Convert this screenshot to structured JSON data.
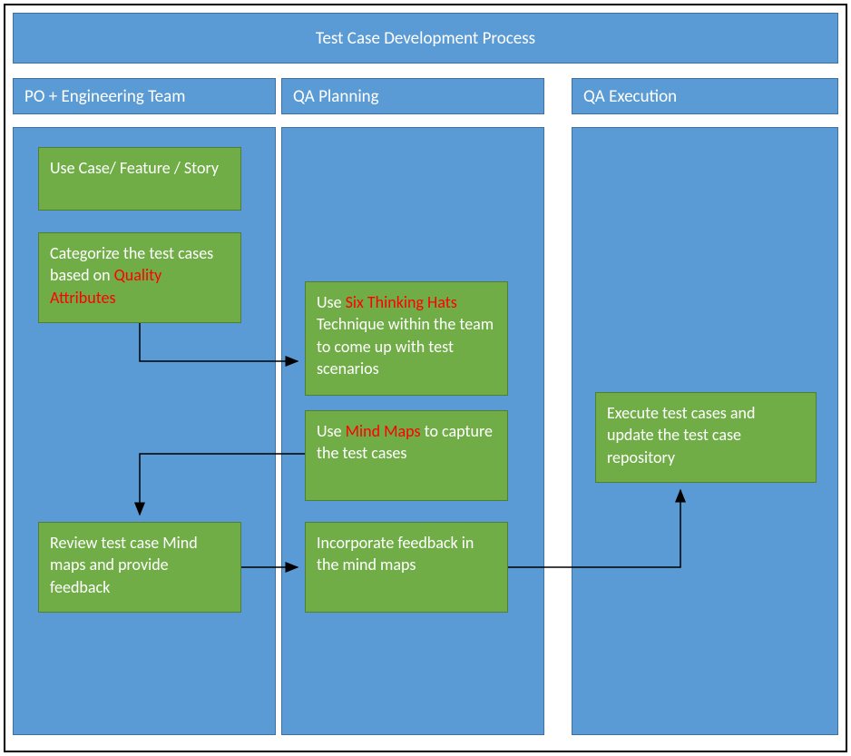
{
  "title": "Test Case Development Process",
  "columns": {
    "col1": {
      "header": "PO + Engineering Team"
    },
    "col2": {
      "header": "QA Planning"
    },
    "col3": {
      "header": "QA Execution"
    }
  },
  "boxes": {
    "usecase": {
      "text": "Use Case/ Feature / Story"
    },
    "categorize": {
      "pre": "Categorize the test cases based on ",
      "red": "Quality Attributes"
    },
    "sixhats": {
      "pre": "Use ",
      "red": "Six Thinking Hats",
      "post": " Technique within the team to come up with test scenarios"
    },
    "mindmaps": {
      "pre": "Use ",
      "red": "Mind Maps",
      "post": " to capture the test cases"
    },
    "review": {
      "text": "Review test case Mind maps and provide feedback"
    },
    "incorporate": {
      "text": "Incorporate feedback in the mind maps"
    },
    "execute": {
      "text": "Execute test cases and update the test case repository"
    }
  }
}
